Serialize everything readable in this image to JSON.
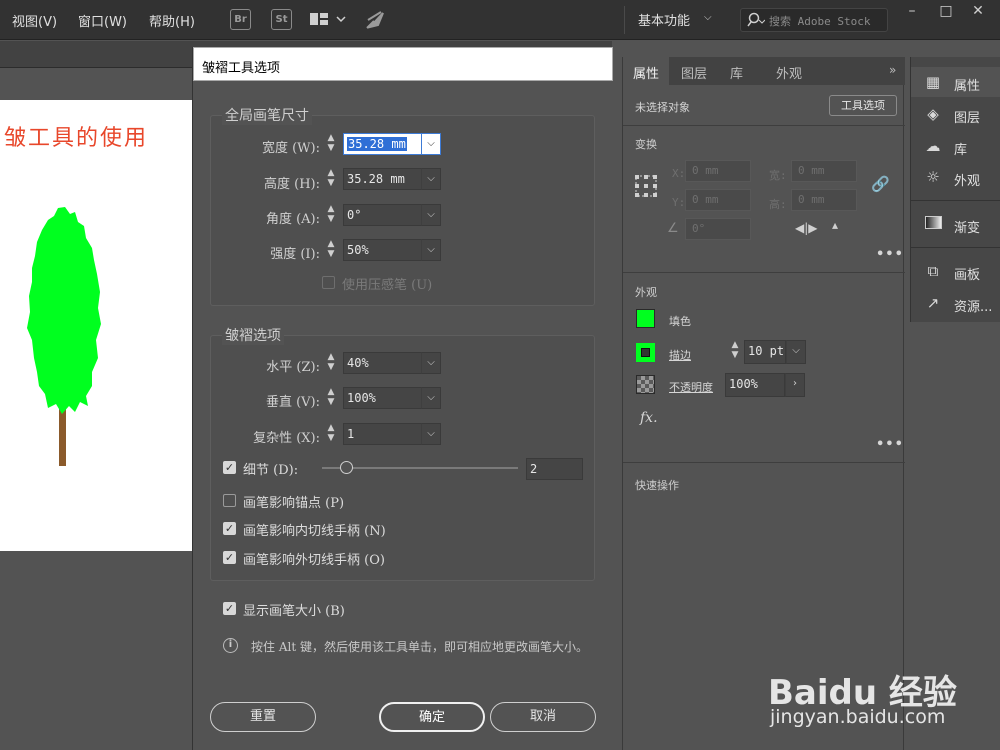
{
  "menubar": {
    "items": [
      "视图(V)",
      "窗口(W)",
      "帮助(H)"
    ],
    "bridge_icon": "Br",
    "stock_icon": "St",
    "workspace_label": "基本功能",
    "search_placeholder": "搜索 Adobe Stock"
  },
  "artboard": {
    "title": "皱工具的使用"
  },
  "dialog": {
    "title": "皱褶工具选项",
    "global_brush_group": "全局画笔尺寸",
    "width_label": "宽度 (W):",
    "width_value": "35.28 mm",
    "height_label": "高度 (H):",
    "height_value": "35.28 mm",
    "angle_label": "角度 (A):",
    "angle_value": "0°",
    "intensity_label": "强度 (I):",
    "intensity_value": "50%",
    "pressure_label": "使用压感笔 (U)",
    "crinkle_group": "皱褶选项",
    "horizontal_label": "水平 (Z):",
    "horizontal_value": "40%",
    "vertical_label": "垂直 (V):",
    "vertical_value": "100%",
    "complexity_label": "复杂性 (X):",
    "complexity_value": "1",
    "detail_label": "细节 (D):",
    "detail_value": "2",
    "detail_slider_fraction": 0.12,
    "anchor_label": "画笔影响锚点 (P)",
    "in_tangent_label": "画笔影响内切线手柄 (N)",
    "out_tangent_label": "画笔影响外切线手柄 (O)",
    "show_size_label": "显示画笔大小 (B)",
    "info_text": "按住 Alt 键，然后使用该工具单击，即可相应地更改画笔大小。",
    "reset_button": "重置",
    "ok_button": "确定",
    "cancel_button": "取消"
  },
  "properties": {
    "tabs": [
      "属性",
      "图层",
      "库",
      "外观"
    ],
    "no_selection": "未选择对象",
    "tool_options_button": "工具选项",
    "transform_section": "变换",
    "x_label": "X:",
    "x_value": "0 mm",
    "y_label": "Y:",
    "y_value": "0 mm",
    "w_label": "宽:",
    "w_value": "0 mm",
    "h_label": "高:",
    "h_value": "0 mm",
    "angle_value": "0°",
    "appearance_section": "外观",
    "fill_label": "填色",
    "stroke_label": "描边",
    "stroke_value": "10 pt",
    "opacity_label": "不透明度",
    "opacity_value": "100%",
    "fx_label": "fx.",
    "quick_actions_section": "快速操作",
    "swatch_color": "#00ff1f"
  },
  "dock": {
    "items": [
      "属性",
      "图层",
      "库",
      "外观",
      "渐变",
      "画板",
      "资源..."
    ]
  },
  "watermark": {
    "main": "Baidu 经验",
    "sub": "jingyan.baidu.com"
  },
  "colors": {
    "tree_foliage": "#00ff1f",
    "tree_trunk": "#8b5a2b",
    "title_red": "#e8472b"
  }
}
